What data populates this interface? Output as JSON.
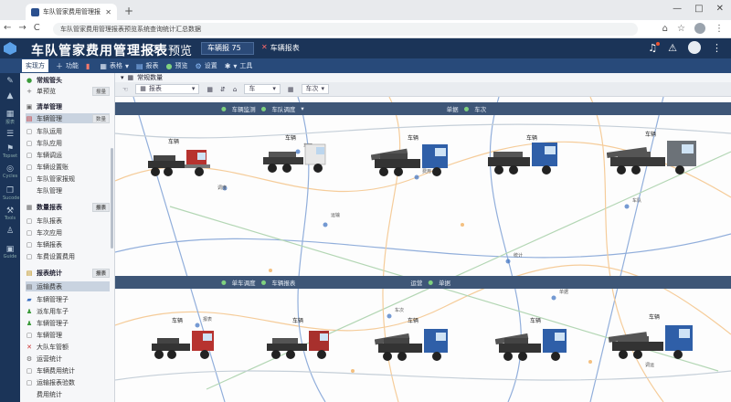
{
  "browser": {
    "tab_title": "车队管家费用管理报 Com.ed",
    "url": "车队管家费用管理报表预览系统查询统计汇总数据",
    "nav": [
      "←",
      "→",
      "C"
    ],
    "window_buttons": [
      "—",
      "□",
      "✕"
    ]
  },
  "app": {
    "title": "车队管家费用管理报表",
    "preview_label": "预览",
    "header_select": "车辆报 75",
    "header_close": "车辆报表",
    "colors": {
      "header": "#1b3458",
      "toolbar": "#284a7a",
      "band": "#3e5677"
    }
  },
  "toolbar": [
    {
      "icon": "home-icon",
      "label": "实现方"
    },
    {
      "icon": "plus-icon",
      "label": "功能"
    },
    {
      "icon": "chart-icon",
      "label": ""
    },
    {
      "icon": "grid-icon",
      "label": "表格"
    },
    {
      "icon": "doc-icon",
      "label": "报表"
    },
    {
      "icon": "check-icon",
      "label": "预览"
    },
    {
      "icon": "settings-icon",
      "label": "设置"
    },
    {
      "icon": "gear-icon",
      "label": "工具"
    }
  ],
  "rail": [
    {
      "icon": "pencil-icon",
      "label": ""
    },
    {
      "icon": "warning-icon",
      "label": ""
    },
    {
      "icon": "table-icon",
      "label": "报表"
    },
    {
      "icon": "list-icon",
      "label": ""
    },
    {
      "icon": "flag-icon",
      "label": "Topset"
    },
    {
      "icon": "target-icon",
      "label": "Cycles"
    },
    {
      "icon": "copy-icon",
      "label": "Sucode"
    },
    {
      "icon": "tools-icon",
      "label": "Tools"
    },
    {
      "icon": "person-icon",
      "label": ""
    },
    {
      "icon": "box-icon",
      "label": "Guide"
    }
  ],
  "side": {
    "items": [
      {
        "label": "常规管头",
        "type": "header"
      },
      {
        "label": "单预览",
        "tag": "报量"
      },
      {
        "label": "清单管理",
        "type": "header"
      },
      {
        "label": "车辆管理",
        "tag": "数量",
        "selected": true
      },
      {
        "label": "车队运用"
      },
      {
        "label": "车队应用"
      },
      {
        "label": "车辆调运"
      },
      {
        "label": "车辆设置账"
      },
      {
        "label": "车队管家报规"
      },
      {
        "label": "车队管理"
      },
      {
        "label": "数量报表",
        "type": "header",
        "tag": "报表"
      },
      {
        "label": "车队报表"
      },
      {
        "label": "车次应用"
      },
      {
        "label": "车辆报表"
      },
      {
        "label": "车费设置费用"
      },
      {
        "label": "报表统计",
        "type": "header",
        "tag": "报表"
      },
      {
        "label": "运输费表",
        "selected": true
      },
      {
        "label": "车辆管理子"
      },
      {
        "label": "派车用车子"
      },
      {
        "label": "车辆管理子"
      },
      {
        "label": "车辆管理"
      },
      {
        "label": "大队车管额"
      },
      {
        "label": "运营统计"
      },
      {
        "label": "车辆费用统计"
      },
      {
        "label": "运输报表验数"
      },
      {
        "label": "费用统计"
      }
    ]
  },
  "main": {
    "subhead": "常规数量",
    "filters": [
      "报表",
      "车",
      "车次"
    ],
    "band1": [
      "车辆监测",
      "车队调度",
      "单据",
      "车次"
    ],
    "band2": [
      "单车调度",
      "车辆报表",
      "运营",
      "单据"
    ],
    "row1_labels": [
      "车辆",
      "车辆",
      "车辆",
      "车辆",
      "车辆"
    ],
    "row2_labels": [
      "车辆",
      "车辆",
      "车辆",
      "车辆",
      "车辆"
    ],
    "node_labels": [
      "调度",
      "运输",
      "费用",
      "统计",
      "车队",
      "报表",
      "车次",
      "单据",
      "调运",
      "车辆"
    ]
  }
}
